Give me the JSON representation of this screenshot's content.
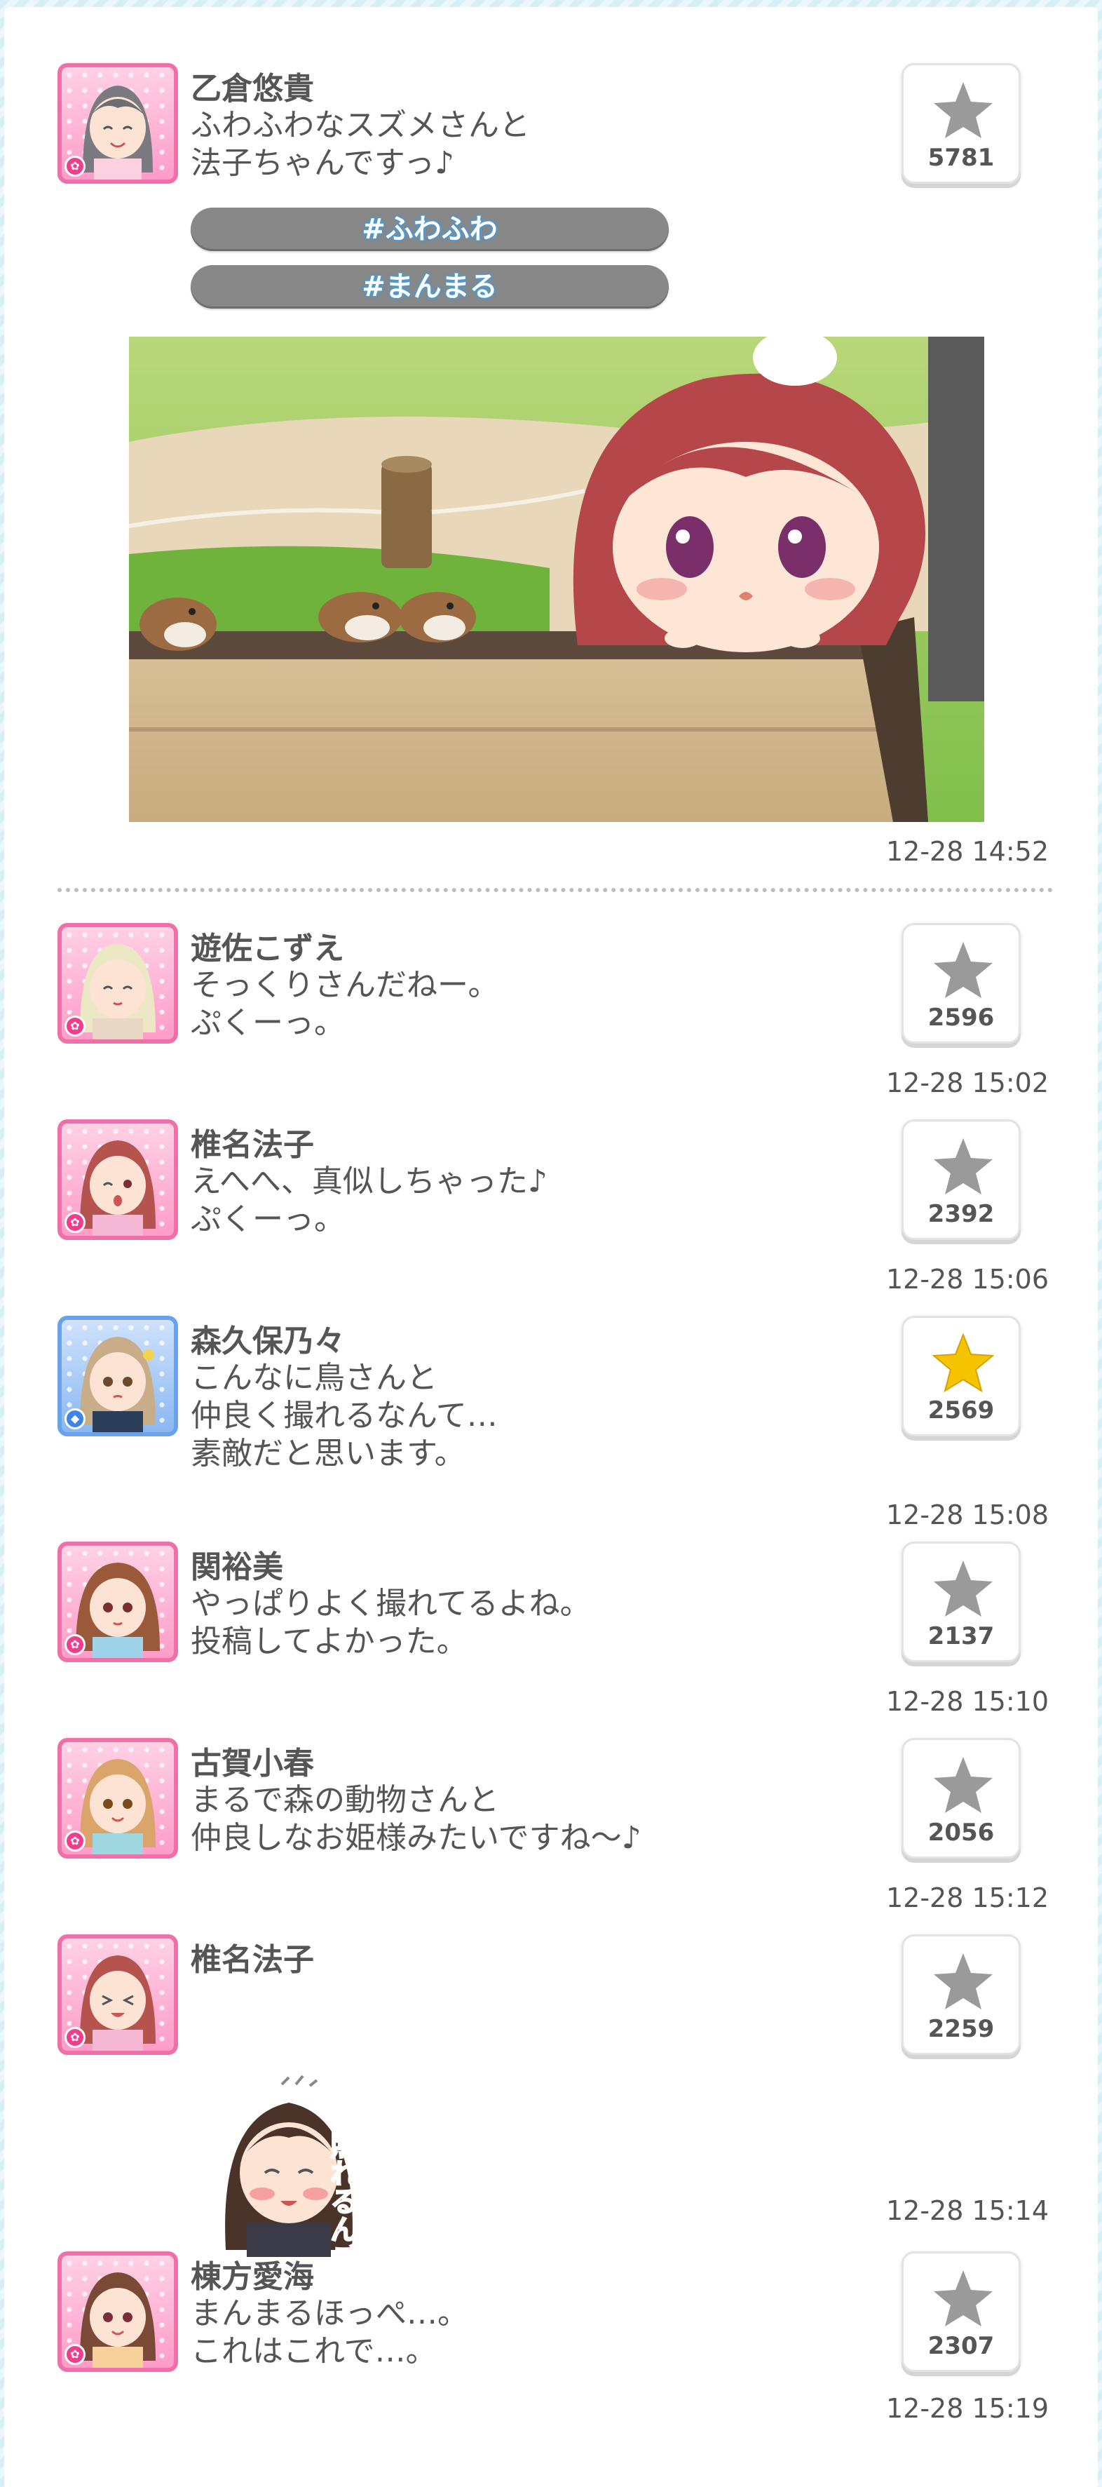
{
  "colors": {
    "accent_pink": "#ef6fa8",
    "accent_blue": "#6aa2ea",
    "tag_bg": "#888888",
    "tag_glow": "#3aa0e8",
    "star_gray": "#9a9a9a",
    "star_gold": "#f5c400",
    "text": "#555555"
  },
  "main_post": {
    "author": "乙倉悠貴",
    "message": "ふわふわなスズメさんと\n法子ちゃんですっ♪",
    "tags": [
      "#ふわふわ",
      "#まんまる"
    ],
    "likes": "5781",
    "liked": false,
    "time": "12-28 14:52",
    "avatar_icon": "girl-avatar-icon",
    "photo_icon": "sparrows-bench-photo"
  },
  "replies": [
    {
      "author": "遊佐こずえ",
      "message": "そっくりさんだねー。\nぷくーっ。",
      "likes": "2596",
      "liked": false,
      "time": "12-28 15:02",
      "theme": "pink"
    },
    {
      "author": "椎名法子",
      "message": "えへへ、真似しちゃった♪\nぷくーっ。",
      "likes": "2392",
      "liked": false,
      "time": "12-28 15:06",
      "theme": "pink"
    },
    {
      "author": "森久保乃々",
      "message": "こんなに鳥さんと\n仲良く撮れるなんて…\n素敵だと思います。",
      "likes": "2569",
      "liked": true,
      "time": "12-28 15:08",
      "theme": "blue"
    },
    {
      "author": "関裕美",
      "message": "やっぱりよく撮れてるよね。\n投稿してよかった。",
      "likes": "2137",
      "liked": false,
      "time": "12-28 15:10",
      "theme": "pink"
    },
    {
      "author": "古賀小春",
      "message": "まるで森の動物さんと\n仲良しなお姫様みたいですね～♪",
      "likes": "2056",
      "liked": false,
      "time": "12-28 15:12",
      "theme": "pink"
    },
    {
      "author": "椎名法子",
      "message": "",
      "sticker_text": "照れるんごー！",
      "likes": "2259",
      "liked": false,
      "time": "12-28 15:14",
      "theme": "pink"
    },
    {
      "author": "棟方愛海",
      "message": "まんまるほっぺ…。\nこれはこれで…。",
      "likes": "2307",
      "liked": false,
      "time": "12-28 15:19",
      "theme": "pink"
    }
  ]
}
